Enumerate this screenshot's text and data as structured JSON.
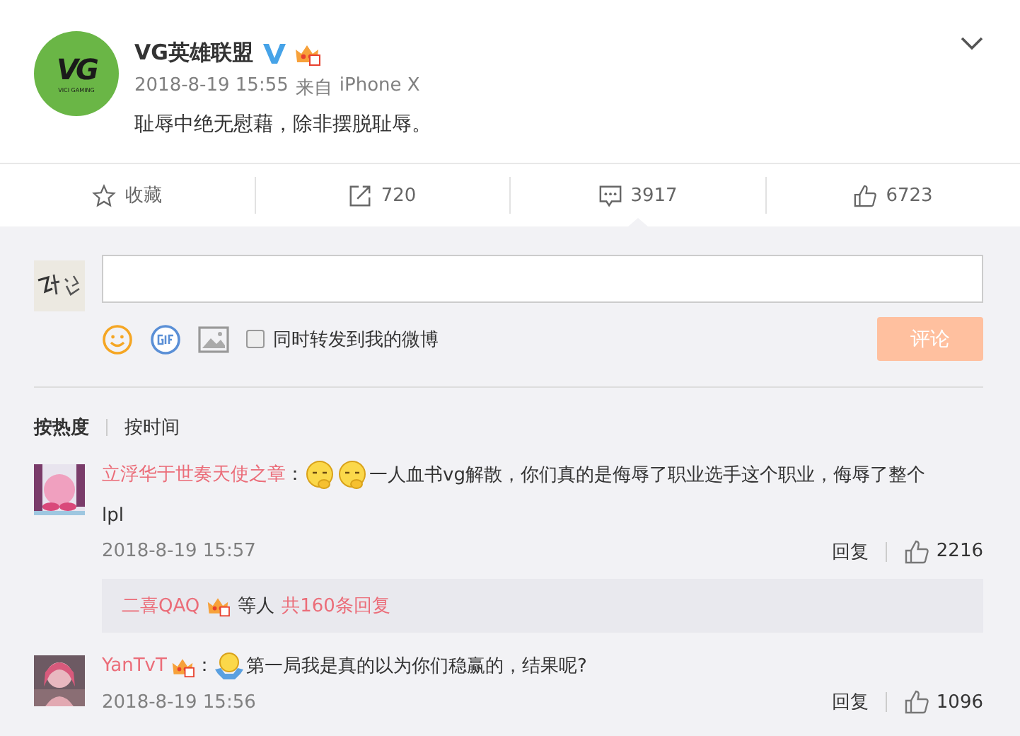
{
  "post": {
    "author": "VG英雄联盟",
    "logo_text": "VG",
    "logo_subtext": "VICI GAMING",
    "verified": true,
    "vip": true,
    "time": "2018-8-19 15:55",
    "source_prefix": "来自",
    "source": "iPhone X",
    "text": "耻辱中绝无慰藉，除非摆脱耻辱。"
  },
  "actions": [
    {
      "kind": "favorite",
      "label": "收藏",
      "selected": false
    },
    {
      "kind": "repost",
      "label": "720",
      "selected": false
    },
    {
      "kind": "comment",
      "label": "3917",
      "selected": true
    },
    {
      "kind": "like",
      "label": "6723",
      "selected": false
    }
  ],
  "composer": {
    "repost_label": "同时转发到我的微博",
    "repost_checked": false,
    "submit": "评论",
    "submit_disabled": true
  },
  "sort_tabs": [
    {
      "label": "按热度",
      "selected": true
    },
    {
      "label": "按时间",
      "selected": false
    }
  ],
  "comments": [
    {
      "author": "立浮华于世奏天使之章",
      "colon": "：",
      "emojis": [
        {
          "kind": "think"
        },
        {
          "kind": "think"
        }
      ],
      "text": "一人血书vg解散，你们真的是侮辱了职业选手这个职业，侮辱了整个lpl",
      "time": "2018-8-19 15:57",
      "reply_label": "回复",
      "likes": "2216",
      "replies": {
        "names": "二喜QAQ",
        "vip": true,
        "middle": "等人",
        "count": "共160条回复"
      }
    },
    {
      "author": "YanTvT",
      "vip": true,
      "colon": "：",
      "emojis": [
        {
          "kind": "shrug"
        }
      ],
      "text": "第一局我是真的以为你们稳赢的，结果呢?",
      "time": "2018-8-19 15:56",
      "reply_label": "回复",
      "likes": "1096"
    }
  ]
}
